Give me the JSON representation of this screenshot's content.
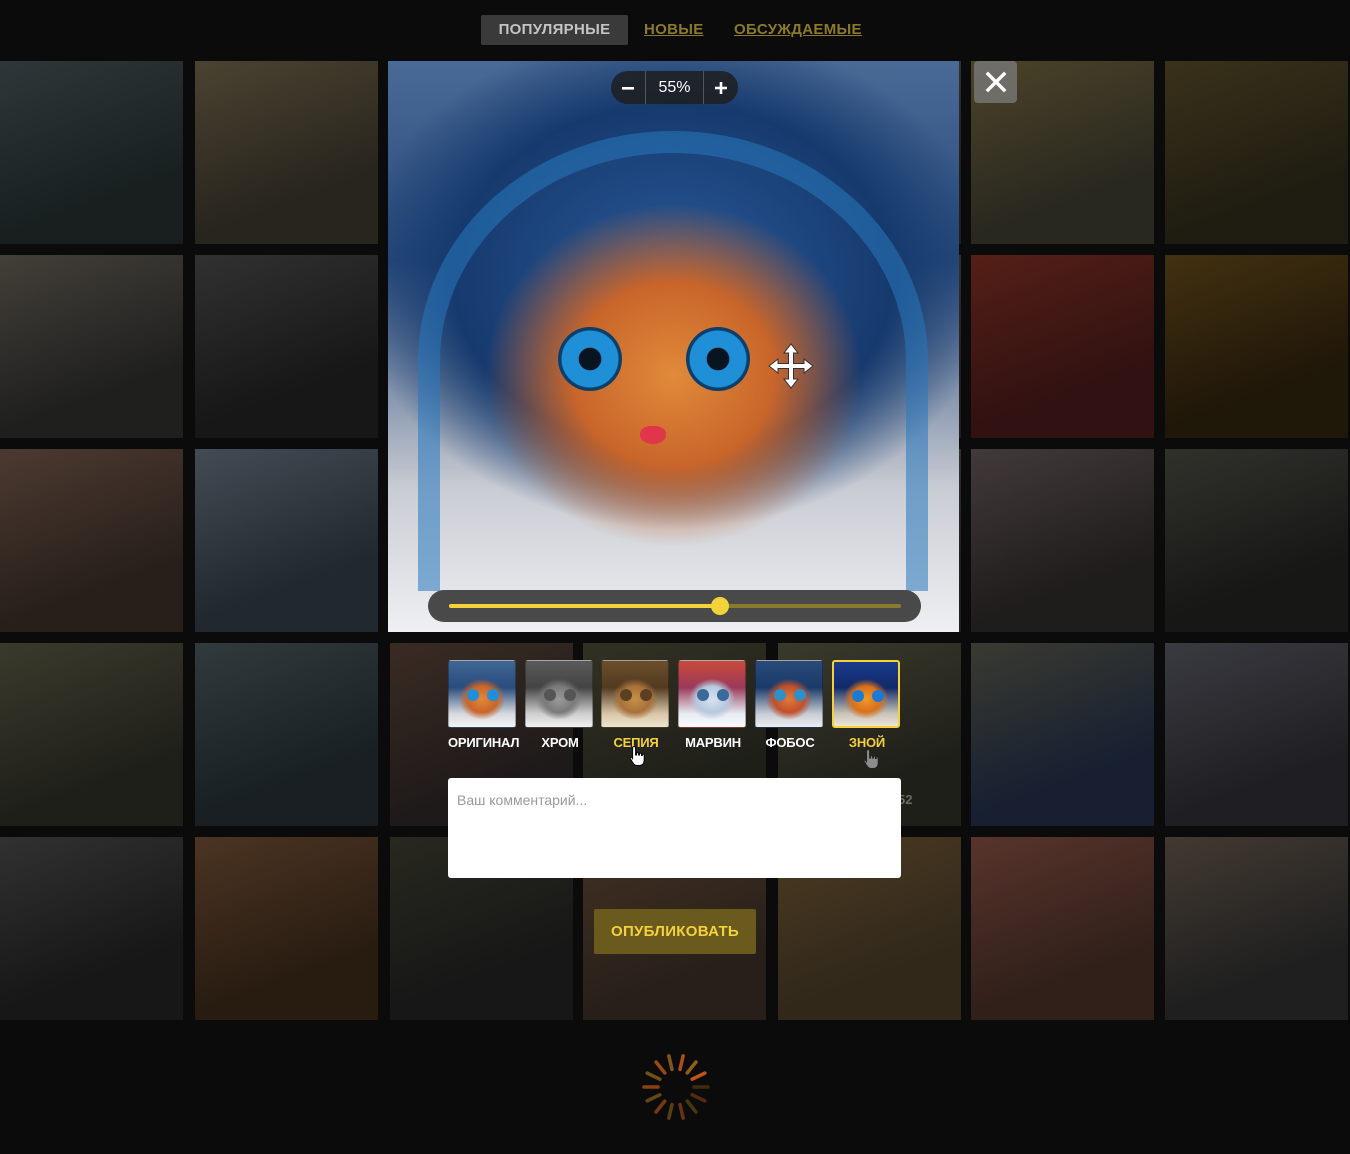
{
  "nav": {
    "tabs": [
      {
        "label": "ПОПУЛЯРНЫЕ",
        "active": true
      },
      {
        "label": "НОВЫЕ",
        "active": false
      },
      {
        "label": "ОБСУЖДАЕМЫЕ",
        "active": false
      }
    ]
  },
  "editor": {
    "zoom_value": "55%",
    "zoom_in_icon": "plus-icon",
    "zoom_out_icon": "minus-icon",
    "slider_value": 0.6,
    "close_icon": "close-icon",
    "move_icon": "move-icon"
  },
  "filters": [
    {
      "label": "ОРИГИНАЛ",
      "highlight": false,
      "selected": false
    },
    {
      "label": "ХРОМ",
      "highlight": false,
      "selected": false
    },
    {
      "label": "СЕПИЯ",
      "highlight": true,
      "selected": false
    },
    {
      "label": "МАРВИН",
      "highlight": false,
      "selected": false
    },
    {
      "label": "ФОБОС",
      "highlight": false,
      "selected": false
    },
    {
      "label": "ЗНОЙ",
      "highlight": true,
      "selected": true
    }
  ],
  "comment": {
    "placeholder": "Ваш комментарий..."
  },
  "publish_label": "ОПУБЛИКОВАТЬ",
  "background_badge": "52",
  "colors": {
    "accent": "#f4d23c",
    "accent_dim": "#6a5a1e",
    "background": "#0b0b0b"
  }
}
